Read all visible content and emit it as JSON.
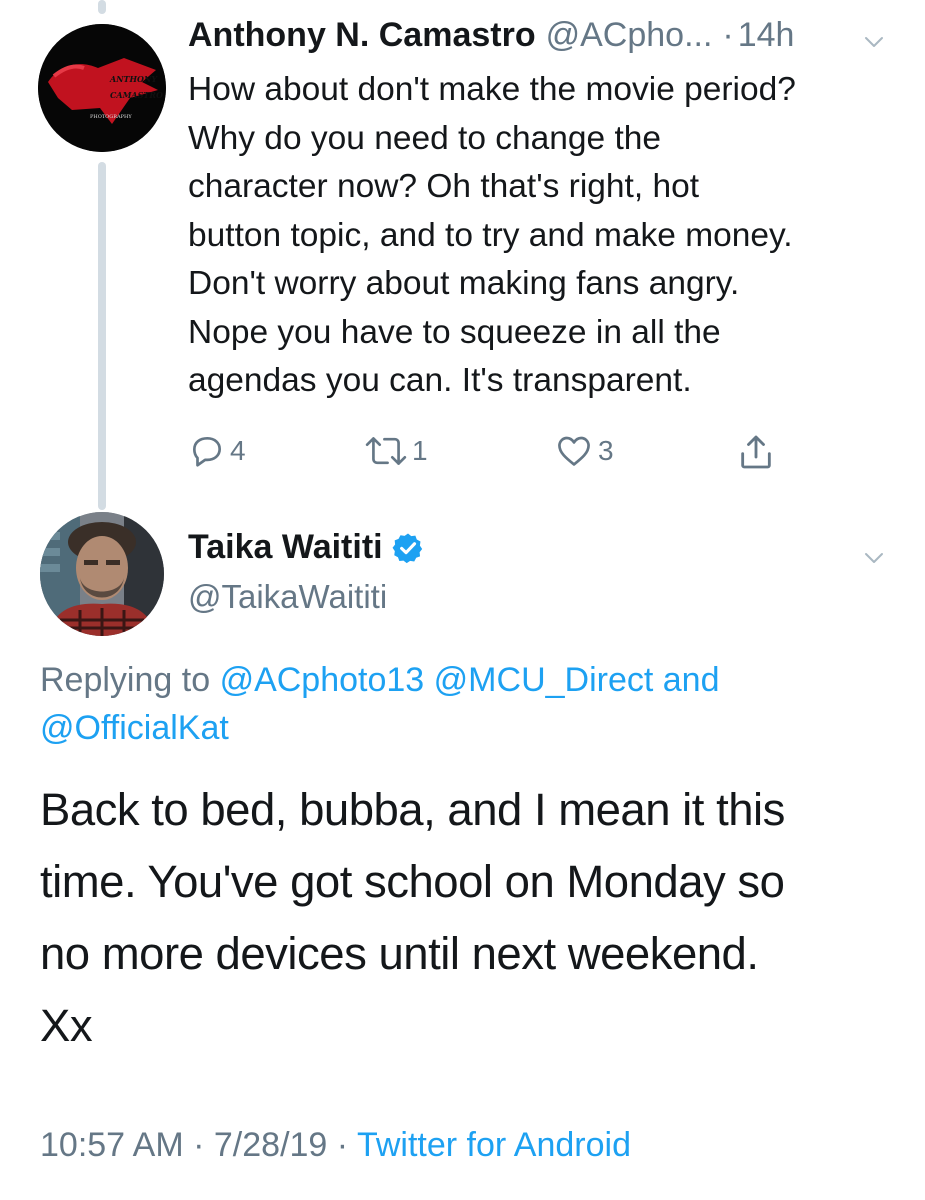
{
  "tweet1": {
    "name": "Anthony N. Camastro",
    "handle": "@ACpho...",
    "separator": "·",
    "time": "14h",
    "avatar_text_1": "ANTHONY",
    "avatar_text_2": "CAMASTRO",
    "avatar_text_3": "PHOTOGRAPHY",
    "body": "How about don't make the movie period?\nWhy do you need to change the\ncharacter now? Oh that's right,  hot\nbutton topic, and to try and make money.\nDon't worry about making fans angry.\nNope you have to squeeze in all the\nagendas you can.  It's transparent.",
    "replies": "4",
    "retweets": "1",
    "likes": "3",
    "icons": {
      "reply": "reply-icon",
      "retweet": "retweet-icon",
      "like": "heart-icon",
      "share": "share-icon",
      "menu": "chevron-down-icon"
    }
  },
  "tweet2": {
    "name": "Taika Waititi",
    "handle": "@TaikaWaititi",
    "replying_prefix": "Replying to",
    "mention1": "@ACphoto13",
    "mention2": "@MCU_Direct",
    "and_word": "and",
    "mention3": "@OfficialKat",
    "text": "Back to bed, bubba, and I mean it this\ntime. You've got school on Monday so\nno more devices until next weekend.\nXx",
    "time": "10:57 AM",
    "sep1": "·",
    "date": "7/28/19",
    "sep2": "·",
    "source": "Twitter for Android",
    "icons": {
      "verified": "verified-badge-icon",
      "menu": "chevron-down-icon"
    }
  },
  "colors": {
    "link": "#1da1f2",
    "secondary": "#657786",
    "text": "#14171a",
    "thread_line": "#d3dce3",
    "like_red": "#e0245e"
  }
}
